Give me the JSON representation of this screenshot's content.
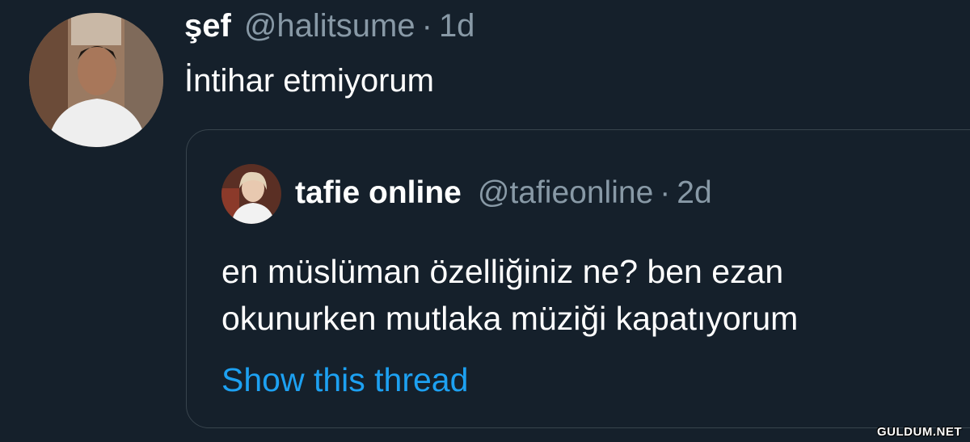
{
  "tweet": {
    "author_name": "şef",
    "handle": "@halitsume",
    "separator": "·",
    "time": "1d",
    "text": "İntihar etmiyorum",
    "avatar_icon": "user-photo-avatar"
  },
  "quoted_tweet": {
    "author_name": "tafie online",
    "handle": "@tafieonline",
    "separator": "·",
    "time": "2d",
    "text_lines": [
      "en müslüman özelliğiniz ne? ben ezan",
      "okunurken mutlaka müziği kapatıyorum"
    ],
    "show_thread_label": "Show this thread",
    "avatar_icon": "user-photo-avatar"
  },
  "watermark": "GULDUM.NET",
  "colors": {
    "background": "#15202b",
    "primary_text": "#ffffff",
    "secondary_text": "#8899a6",
    "link": "#1da1f2",
    "border": "#38444d"
  }
}
